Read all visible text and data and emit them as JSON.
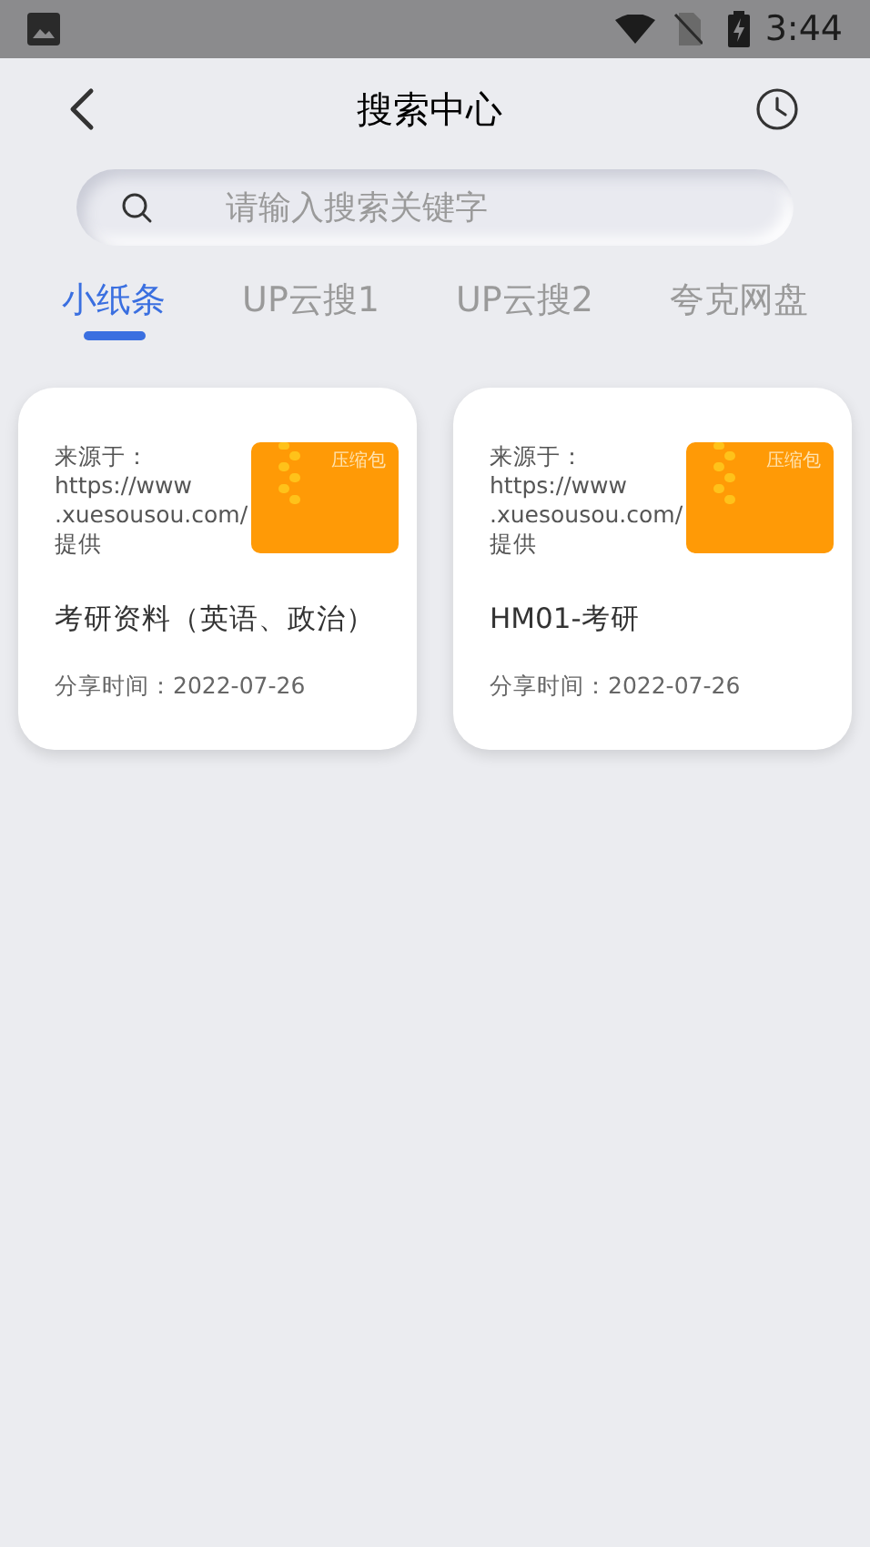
{
  "status_bar": {
    "time": "3:44"
  },
  "header": {
    "title": "搜索中心"
  },
  "search": {
    "placeholder": "请输入搜索关键字"
  },
  "tabs": [
    {
      "label": "小纸条",
      "selected": true
    },
    {
      "label": "UP云搜1",
      "selected": false
    },
    {
      "label": "UP云搜2",
      "selected": false
    },
    {
      "label": "夸克网盘",
      "selected": false
    }
  ],
  "results": [
    {
      "source_lines": [
        "来源于：",
        "https://www",
        ".xuesousou.com/",
        "提供"
      ],
      "file_type": "压缩包",
      "title": "考研资料（英语、政治）",
      "shared": "分享时间：2022-07-26"
    },
    {
      "source_lines": [
        "来源于：",
        "https://www",
        ".xuesousou.com/",
        "提供"
      ],
      "file_type": "压缩包",
      "title": "HM01-考研",
      "shared": "分享时间：2022-07-26"
    }
  ]
}
